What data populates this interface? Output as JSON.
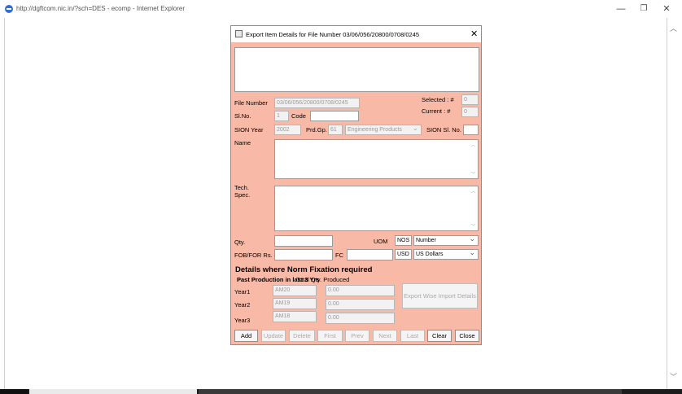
{
  "browser": {
    "title": "http://dgftcom.nic.in/?sch=DES - ecomp - Internet Explorer",
    "minimize": "—",
    "restore": "❐",
    "close": "✕",
    "scroll_up": "︿",
    "scroll_down": "﹀"
  },
  "dialog": {
    "title": "Export Item Details for File Number 03/06/056/20800/0708/0245",
    "close": "✕",
    "file_number_label": "File Number",
    "file_number_value": "03/06/056/20800/0708/0245",
    "selected_label": "Selected : #",
    "selected_value": "0",
    "current_label": "Current : #",
    "current_value": "0",
    "slno_label": "Sl.No.",
    "slno_value": "1",
    "code_label": "Code",
    "code_value": "",
    "sion_year_label": "SION Year",
    "sion_year_value": "2002",
    "prdgp_label": "Prd.Gp.",
    "prdgp_value": "61",
    "product_group": "Engineering Products",
    "sion_slno_label": "SION Sl. No.",
    "sion_slno_value": "",
    "name_label": "Name",
    "name_value": "",
    "tech_label": "Tech.",
    "spec_label": "Spec.",
    "tech_spec_value": "",
    "qty_label": "Qty.",
    "qty_value": "",
    "uom_label": "UOM",
    "uom_code": "NOS",
    "uom_name": "Number",
    "fob_label": "FOB/FOR Rs.",
    "fob_value": "",
    "fc_label": "FC",
    "fc_value": "",
    "currency_code": "USD",
    "currency_name": "US Dollars",
    "norm_heading": "Details where Norm Fixation required",
    "past_production_label": "Past Production in last 3 Yrs",
    "total_qty_label": "Total Qty. Produced",
    "years": [
      {
        "label": "Year1",
        "year": "AM20",
        "qty": "0.00"
      },
      {
        "label": "Year2",
        "year": "AM19",
        "qty": "0.00"
      },
      {
        "label": "Year3",
        "year": "AM18",
        "qty": "0.00"
      }
    ],
    "export_wise_button": "Export Wise Import Details",
    "buttons": {
      "add": "Add",
      "update": "Update",
      "delete": "Delete",
      "first": "First",
      "prev": "Prev",
      "next": "Next",
      "last": "Last",
      "clear": "Clear",
      "close": "Close"
    }
  }
}
